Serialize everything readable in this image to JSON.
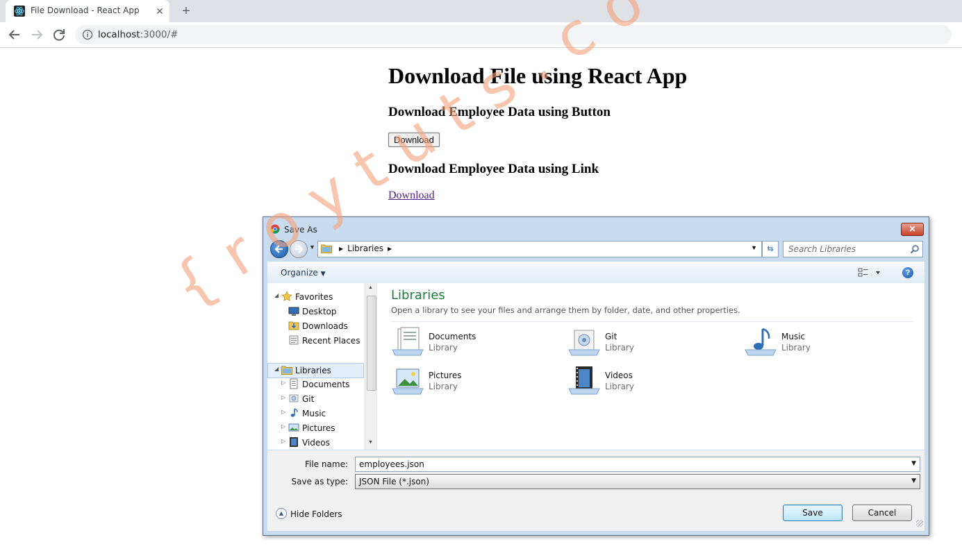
{
  "browser": {
    "tab_title": "File Download - React App",
    "tab_close": "✕",
    "new_tab": "+",
    "url_host": "localhost",
    "url_rest": ":3000/#"
  },
  "page": {
    "heading": "Download File using React App",
    "section_button_heading": "Download Employee Data using Button",
    "download_button_label": "Download",
    "section_link_heading": "Download Employee Data using Link",
    "download_link_label": "Download"
  },
  "watermark": "{roytuts.com}",
  "dialog": {
    "title": "Save As",
    "close_label": "✕",
    "breadcrumb": [
      "Libraries"
    ],
    "search_placeholder": "Search Libraries",
    "organize_label": "Organize",
    "help_label": "?",
    "nav": {
      "favorites_label": "Favorites",
      "favorites": [
        "Desktop",
        "Downloads",
        "Recent Places"
      ],
      "libraries_label": "Libraries",
      "libraries": [
        "Documents",
        "Git",
        "Music",
        "Pictures",
        "Videos"
      ]
    },
    "content": {
      "heading": "Libraries",
      "subtitle": "Open a library to see your files and arrange them by folder, date, and other properties.",
      "items": [
        {
          "name": "Documents",
          "type": "Library",
          "icon": "documents-library-icon"
        },
        {
          "name": "Git",
          "type": "Library",
          "icon": "git-library-icon"
        },
        {
          "name": "Music",
          "type": "Library",
          "icon": "music-library-icon"
        },
        {
          "name": "Pictures",
          "type": "Library",
          "icon": "pictures-library-icon"
        },
        {
          "name": "Videos",
          "type": "Library",
          "icon": "videos-library-icon"
        }
      ]
    },
    "file_name_label": "File name:",
    "file_name_value": "employees.json",
    "save_type_label": "Save as type:",
    "save_type_value": "JSON File (*.json)",
    "hide_folders_label": "Hide Folders",
    "save_label": "Save",
    "cancel_label": "Cancel"
  }
}
